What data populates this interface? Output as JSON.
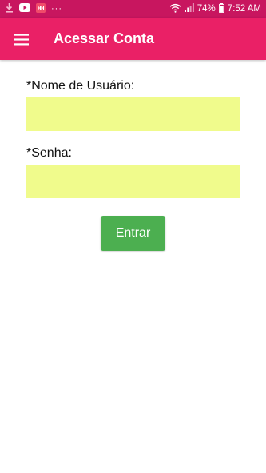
{
  "status_bar": {
    "battery_percent": "74%",
    "time": "7:52 AM",
    "notification_icons": [
      "download-icon",
      "youtube-icon",
      "app-notification-icon"
    ],
    "more_indicator": "···"
  },
  "app_bar": {
    "title": "Acessar Conta",
    "color": "#ea2066"
  },
  "form": {
    "username_label": "*Nome de Usuário:",
    "username_value": "",
    "password_label": "*Senha:",
    "password_value": "",
    "input_color": "#f0fb8c"
  },
  "actions": {
    "submit_label": "Entrar",
    "submit_color": "#4caf50"
  }
}
